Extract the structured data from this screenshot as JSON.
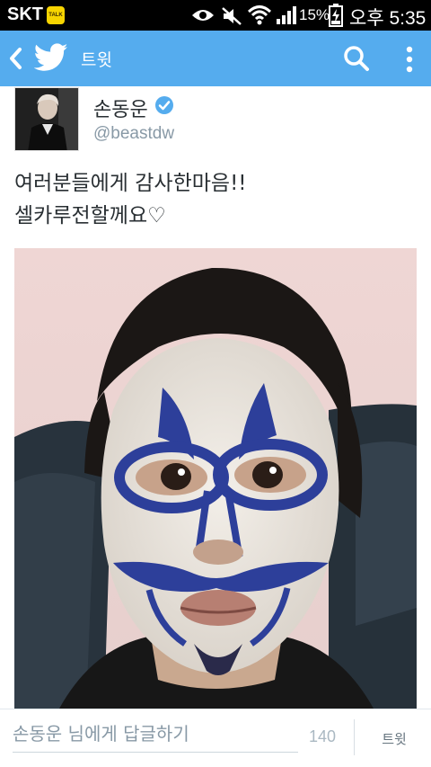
{
  "status_bar": {
    "carrier": "SKT",
    "talk_badge": "TALK",
    "battery_percent": "15%",
    "time": "오후 5:35",
    "icons": [
      "kakaotalk-icon",
      "eye-icon",
      "mute-icon",
      "wifi-icon",
      "signal-icon",
      "battery-charging-icon"
    ]
  },
  "action_bar": {
    "title": "트윗",
    "color": "#55acee",
    "icons": [
      "back-icon",
      "twitter-bird-icon",
      "search-icon",
      "overflow-menu-icon"
    ]
  },
  "tweet": {
    "display_name": "손동운",
    "verified": true,
    "handle": "@beastdw",
    "text_line1": "여러분들에게 감사한마음!!",
    "text_line2": "셀카루전할께요♡"
  },
  "reply": {
    "placeholder": "손동운 님에게 답글하기",
    "char_count": "140",
    "button_label": "트윗"
  }
}
